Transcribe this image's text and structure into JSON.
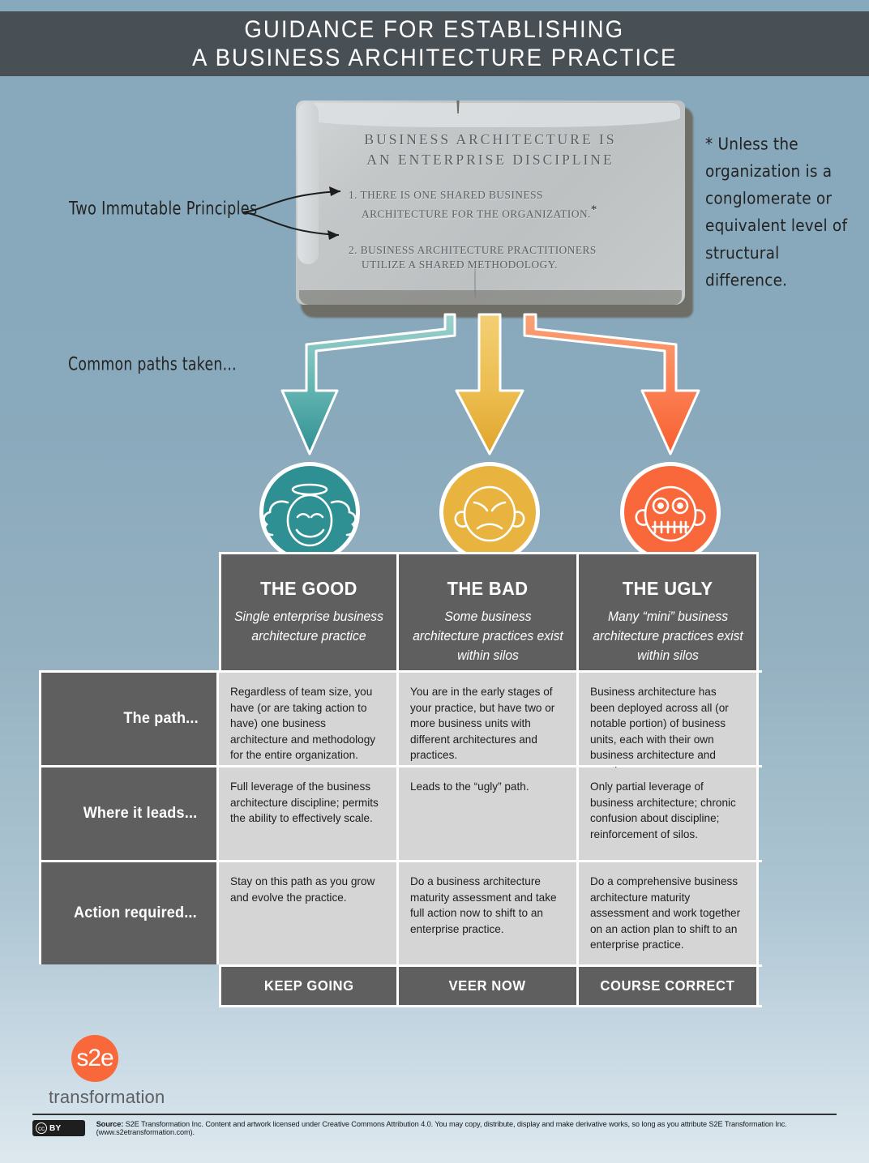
{
  "header": {
    "line1": "GUIDANCE FOR ESTABLISHING",
    "line2": "A BUSINESS ARCHITECTURE PRACTICE",
    "bar_color": "#485055"
  },
  "tablet": {
    "heading_line1": "BUSINESS ARCHITECTURE IS",
    "heading_line2": "AN ENTERPRISE DISCIPLINE",
    "principles": [
      {
        "number": "1.",
        "line1": "THERE IS ONE SHARED BUSINESS",
        "line2": "ARCHITECTURE FOR THE ORGANIZATION.",
        "asterisk": "*"
      },
      {
        "number": "2.",
        "line1": "BUSINESS ARCHITECTURE PRACTITIONERS",
        "line2": "UTILIZE A SHARED METHODOLOGY.",
        "asterisk": ""
      }
    ]
  },
  "annotations": {
    "two_immutable_principles": "Two Immutable Principles",
    "common_paths_taken": "Common paths taken...",
    "footnote": "* Unless the organization is a conglomerate or equivalent level of structural difference."
  },
  "paths": [
    {
      "key": "good",
      "color": "#3c9ca0",
      "color_light": "#8ecac6",
      "face": "angel-face-icon"
    },
    {
      "key": "bad",
      "color": "#e8b33e",
      "color_light": "#f2cb70",
      "face": "angry-face-icon"
    },
    {
      "key": "ugly",
      "color": "#f9683a",
      "color_light": "#f79a6d",
      "face": "stitched-mouth-face-icon"
    }
  ],
  "table": {
    "columns": [
      {
        "title": "THE GOOD",
        "subtitle": "Single enterprise business architecture practice",
        "path": "Regardless of team size, you have (or are taking action to have) one business architecture and methodology for the entire organization.",
        "leads": "Full leverage of the business architecture discipline; permits the ability to effectively scale.",
        "action": "Stay on this path as you grow and evolve the practice.",
        "verdict": "KEEP GOING"
      },
      {
        "title": "THE BAD",
        "subtitle": "Some business architecture practices exist within silos",
        "path": "You are in the early stages of your practice, but have two or more business units with different architectures and practices.",
        "leads": "Leads to the “ugly” path.",
        "action": "Do a business architecture maturity assessment and take full action now to shift to an enterprise practice.",
        "verdict": "VEER NOW"
      },
      {
        "title": "THE UGLY",
        "subtitle": "Many “mini” business architecture practices exist within silos",
        "path": "Business architecture has been deployed across all (or notable portion) of business units, each with their own business architecture and practices.",
        "leads": "Only partial leverage of business architecture; chronic confusion about discipline; reinforcement of silos.",
        "action": "Do a comprehensive business architecture maturity assessment and work together on an action plan to shift to an enterprise practice.",
        "verdict": "COURSE CORRECT"
      }
    ],
    "row_labels": {
      "path": "The path...",
      "leads": "Where it leads...",
      "action": "Action required..."
    }
  },
  "logo": {
    "mark": "s2e",
    "word": "transformation",
    "color": "#f9683a"
  },
  "footer": {
    "cc_mark": "cc",
    "cc_by": "BY",
    "source_label": "Source:",
    "text": " S2E Transformation Inc. Content and artwork licensed under Creative Commons Attribution 4.0. You may copy, distribute, display and make derivative works, so long as you attribute S2E Transformation Inc. (www.s2etransformation.com)."
  }
}
